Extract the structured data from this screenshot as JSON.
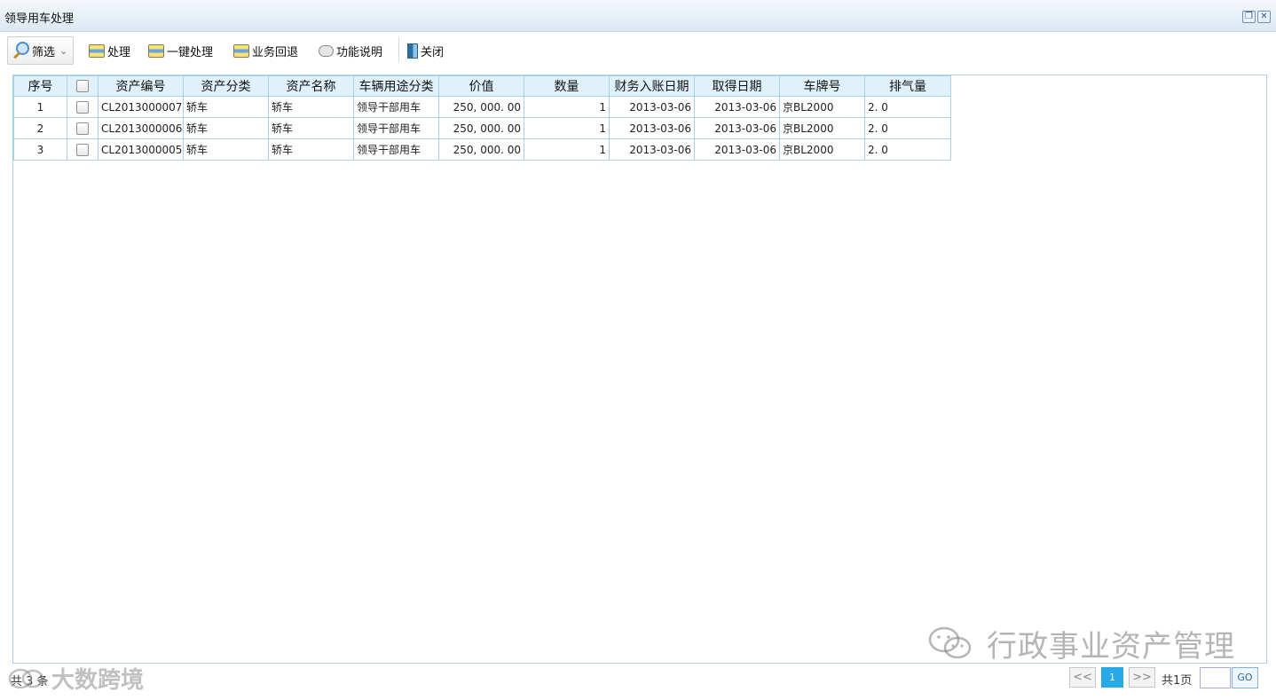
{
  "window": {
    "title": "领导用车处理",
    "restore_icon": "restore-window-icon",
    "close_icon": "close-window-icon"
  },
  "toolbar": {
    "filter_label": "筛选",
    "process_label": "处理",
    "one_click_label": "一键处理",
    "rollback_label": "业务回退",
    "help_label": "功能说明",
    "close_label": "关闭"
  },
  "grid": {
    "columns": [
      "序号",
      "",
      "资产编号",
      "资产分类",
      "资产名称",
      "车辆用途分类",
      "价值",
      "数量",
      "财务入账日期",
      "取得日期",
      "车牌号",
      "排气量"
    ],
    "rows": [
      {
        "seq": "1",
        "asset_no": "CL2013000007",
        "category": "轿车",
        "name": "轿车",
        "usage": "领导干部用车",
        "value": "250, 000. 00",
        "qty": "1",
        "fin_date": "2013-03-06",
        "acq_date": "2013-03-06",
        "plate": "京BL2000",
        "displacement": "2. 0"
      },
      {
        "seq": "2",
        "asset_no": "CL2013000006",
        "category": "轿车",
        "name": "轿车",
        "usage": "领导干部用车",
        "value": "250, 000. 00",
        "qty": "1",
        "fin_date": "2013-03-06",
        "acq_date": "2013-03-06",
        "plate": "京BL2000",
        "displacement": "2. 0"
      },
      {
        "seq": "3",
        "asset_no": "CL2013000005",
        "category": "轿车",
        "name": "轿车",
        "usage": "领导干部用车",
        "value": "250, 000. 00",
        "qty": "1",
        "fin_date": "2013-03-06",
        "acq_date": "2013-03-06",
        "plate": "京BL2000",
        "displacement": "2. 0"
      }
    ]
  },
  "footer": {
    "total_text": "共 3 条",
    "prev_label": "<<",
    "current_page": "1",
    "next_label": ">>",
    "total_pages": "共1页",
    "go_label": "GO",
    "page_input_value": ""
  },
  "watermarks": {
    "right": "行政事业资产管理",
    "left": "大数跨境"
  }
}
